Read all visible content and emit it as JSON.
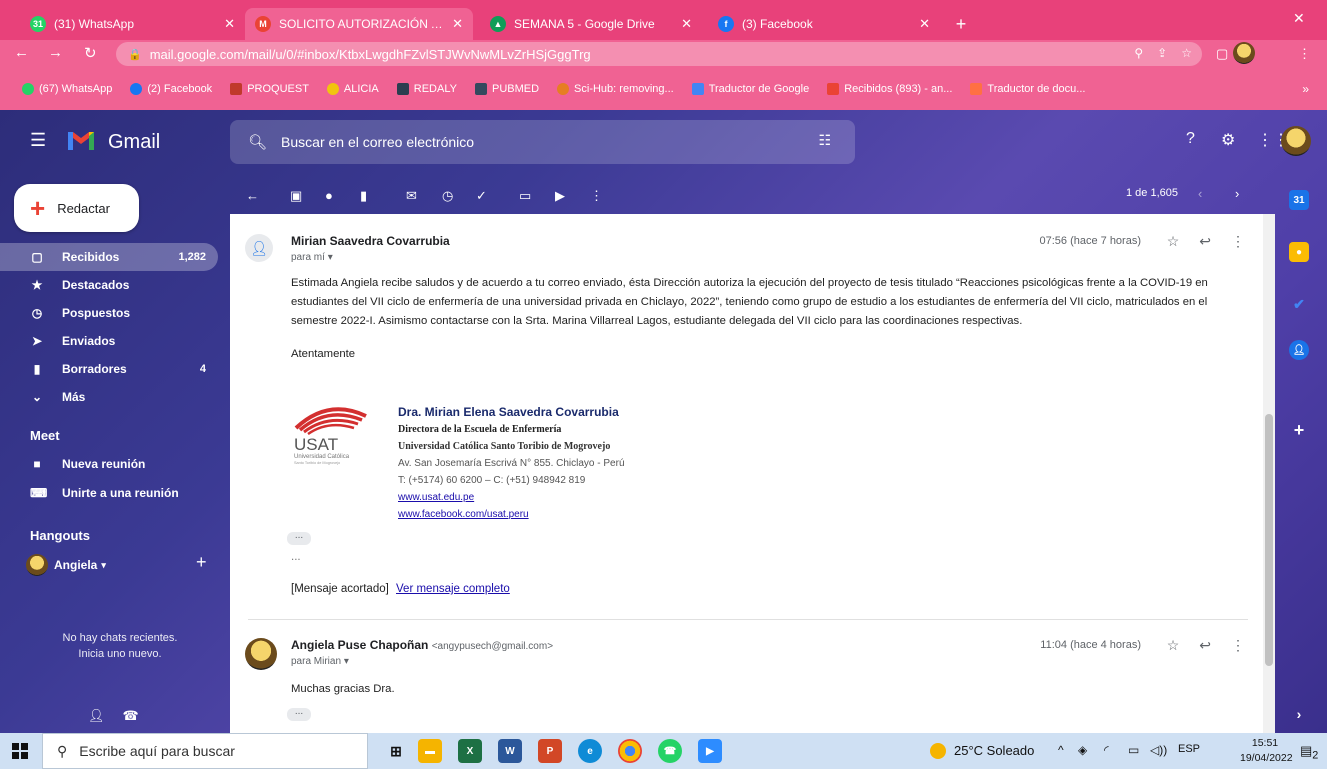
{
  "browser": {
    "tabs": [
      {
        "label": "(31) WhatsApp",
        "badge": "31",
        "color": "#25d366"
      },
      {
        "label": "SOLICITO AUTORIZACIÓN A LA I",
        "badge": "M",
        "color": "#ea4335"
      },
      {
        "label": "SEMANA 5 - Google Drive",
        "badge": "▲",
        "color": "#fbbc04"
      },
      {
        "label": "(3) Facebook",
        "badge": "f",
        "color": "#1877f2"
      }
    ],
    "url": "mail.google.com/mail/u/0/#inbox/KtbxLwgdhFZvlSTJWvNwMLvZrHSjGggTrg",
    "bookmarks": [
      {
        "label": "(67) WhatsApp",
        "color": "#25d366"
      },
      {
        "label": "(2) Facebook",
        "color": "#1877f2"
      },
      {
        "label": "PROQUEST",
        "color": "#c0392b"
      },
      {
        "label": "ALICIA",
        "color": "#f1c40f"
      },
      {
        "label": "REDALY",
        "color": "#2c3e50"
      },
      {
        "label": "PUBMED",
        "color": "#34495e"
      },
      {
        "label": "Sci-Hub: removing...",
        "color": "#e67e22"
      },
      {
        "label": "Traductor de Google",
        "color": "#4285f4"
      },
      {
        "label": "Recibidos (893) - an...",
        "color": "#ea4335"
      },
      {
        "label": "Traductor de docu...",
        "color": "#e8417a"
      }
    ],
    "bookmarks_more": "»"
  },
  "gmail": {
    "app_name": "Gmail",
    "search_placeholder": "Buscar en el correo electrónico",
    "compose_label": "Redactar",
    "nav": [
      {
        "label": "Recibidos",
        "count": "1,282",
        "icon": "inbox-icon",
        "glyph": "▢",
        "active": true
      },
      {
        "label": "Destacados",
        "count": "",
        "icon": "star-icon",
        "glyph": "★",
        "active": false
      },
      {
        "label": "Pospuestos",
        "count": "",
        "icon": "clock-icon",
        "glyph": "◷",
        "active": false
      },
      {
        "label": "Enviados",
        "count": "",
        "icon": "send-icon",
        "glyph": "➤",
        "active": false
      },
      {
        "label": "Borradores",
        "count": "4",
        "icon": "draft-icon",
        "glyph": "▮",
        "active": false
      },
      {
        "label": "Más",
        "count": "",
        "icon": "chevron-down-icon",
        "glyph": "⌄",
        "active": false
      }
    ],
    "meet": {
      "title": "Meet",
      "items": [
        "Nueva reunión",
        "Unirte a una reunión"
      ]
    },
    "hangouts": {
      "title": "Hangouts",
      "user": "Angiela",
      "empty_line1": "No hay chats recientes.",
      "empty_line2": "Inicia uno nuevo."
    },
    "pager": "1 de 1,605"
  },
  "messages": [
    {
      "sender": "Mirian Saavedra Covarrubia",
      "email": "",
      "to": "para mí",
      "time": "07:56 (hace 7 horas)",
      "body": "Estimada Angiela recibe saludos y de acuerdo a tu correo enviado, ésta Dirección autoriza la ejecución del proyecto de tesis titulado  “Reacciones psicológicas frente a la COVID-19 en estudiantes del VII ciclo de enfermería de una universidad privada en Chiclayo, 2022”, teniendo como grupo de estudio a los estudiantes de enfermería del VII ciclo, matriculados en el semestre 2022-I. Asimismo contactarse con la Srta. Marina Villarreal Lagos, estudiante delegada del VII ciclo para las coordinaciones respectivas.",
      "closing": "Atentamente",
      "signature": {
        "name": "Dra. Mirian Elena Saavedra Covarrubia",
        "title": "Directora de la Escuela de Enfermería",
        "university": "Universidad Católica Santo Toribio de Mogrovejo",
        "address": "Av. San Josemaría Escrivá N° 855. Chiclayo - Perú",
        "phone": "T: (+5174) 60 6200 – C: (+51) 948942 819",
        "web": "www.usat.edu.pe",
        "facebook": "www.facebook.com/usat.peru",
        "logo_text": "USAT",
        "logo_sub1": "Universidad Católica",
        "logo_sub2": "Santo Toribio de Mogrovejo"
      },
      "ellipsis": "...",
      "truncated": "[Mensaje acortado]",
      "full_link": "Ver mensaje completo"
    },
    {
      "sender": "Angiela Puse Chapoñan",
      "email": "<angypusech@gmail.com>",
      "to": "para Mirian",
      "time": "11:04 (hace 4 horas)",
      "body": "Muchas gracias Dra."
    }
  ],
  "taskbar": {
    "search_placeholder": "Escribe aquí para buscar",
    "weather": "25°C  Soleado",
    "lang": "ESP",
    "time": "15:51",
    "date": "19/04/2022",
    "notif_count": "2"
  },
  "colors": {
    "chrome_accent": "#e8417a",
    "gmail_red": "#ea4335",
    "link_blue": "#1a0dab"
  }
}
